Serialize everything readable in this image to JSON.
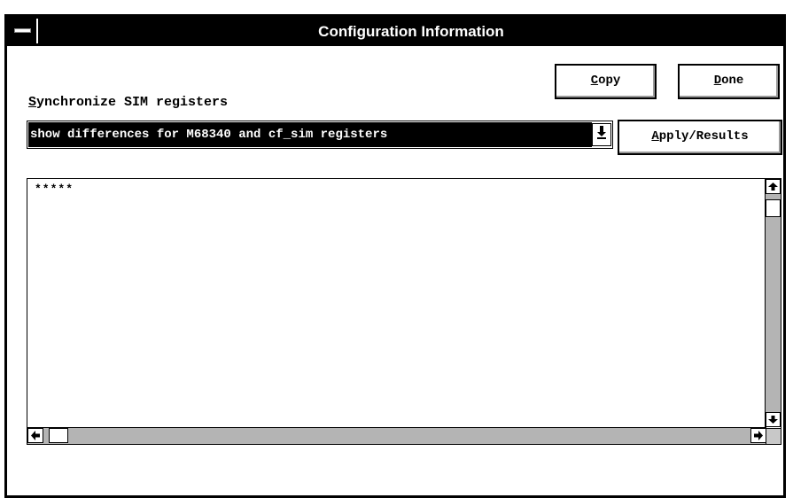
{
  "window": {
    "title": "Configuration Information"
  },
  "sync": {
    "label_mnemonic": "S",
    "label_rest": "ynchronize SIM registers",
    "selected_value": "show differences for M68340 and cf_sim registers"
  },
  "buttons": {
    "copy_mnemonic": "C",
    "copy_rest": "opy",
    "done_mnemonic": "D",
    "done_rest": "one",
    "apply_mnemonic": "A",
    "apply_rest": "pply/Results"
  },
  "results": {
    "text": "*****"
  },
  "icons": {
    "system_menu": "system-menu-icon",
    "dropdown": "dropdown-arrow-icon",
    "scroll_up": "arrow-up-icon",
    "scroll_down": "arrow-down-icon",
    "scroll_left": "arrow-left-icon",
    "scroll_right": "arrow-right-icon"
  }
}
